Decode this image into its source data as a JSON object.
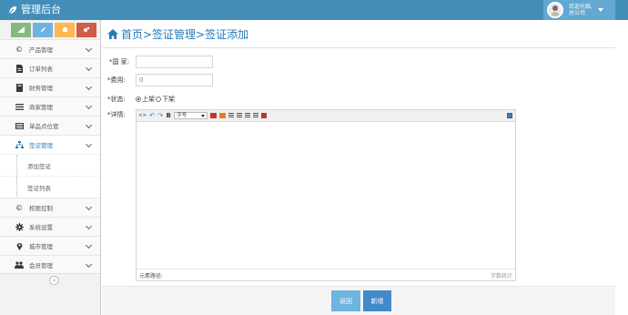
{
  "app": {
    "title": "管理后台"
  },
  "user": {
    "line1": "欢迎光临,",
    "line2": "总公司"
  },
  "sidebar": {
    "items": [
      {
        "label": "产品管理",
        "icon": "copyright-icon"
      },
      {
        "label": "订单列表",
        "icon": "file-icon"
      },
      {
        "label": "财务管理",
        "icon": "book-icon"
      },
      {
        "label": "商家管理",
        "icon": "list-icon"
      },
      {
        "label": "单品点位管",
        "icon": "list-alt-icon"
      },
      {
        "label": "签证管理",
        "icon": "sitemap-icon"
      }
    ],
    "sub_items": [
      "添加签证",
      "签证列表"
    ],
    "bottom_items": [
      {
        "label": "权限控制",
        "icon": "copyright-icon"
      },
      {
        "label": "系统设置",
        "icon": "gear-icon"
      },
      {
        "label": "城市管理",
        "icon": "map-marker-icon"
      },
      {
        "label": "会员管理",
        "icon": "users-icon"
      }
    ],
    "collapse_glyph": "«"
  },
  "page": {
    "breadcrumb": "首页>签证管理>签证添加"
  },
  "form": {
    "country_label": "*国 家:",
    "country_value": "",
    "cost_label": "*费用:",
    "cost_value": "0",
    "status_label": "*状态:",
    "status_on": "上架",
    "status_off": "下架",
    "detail_label": "*详情:",
    "font_select": "字号",
    "path_text": "元素路径:",
    "count_text": "字数统计"
  },
  "buttons": {
    "back": "返回",
    "add": "新增"
  }
}
